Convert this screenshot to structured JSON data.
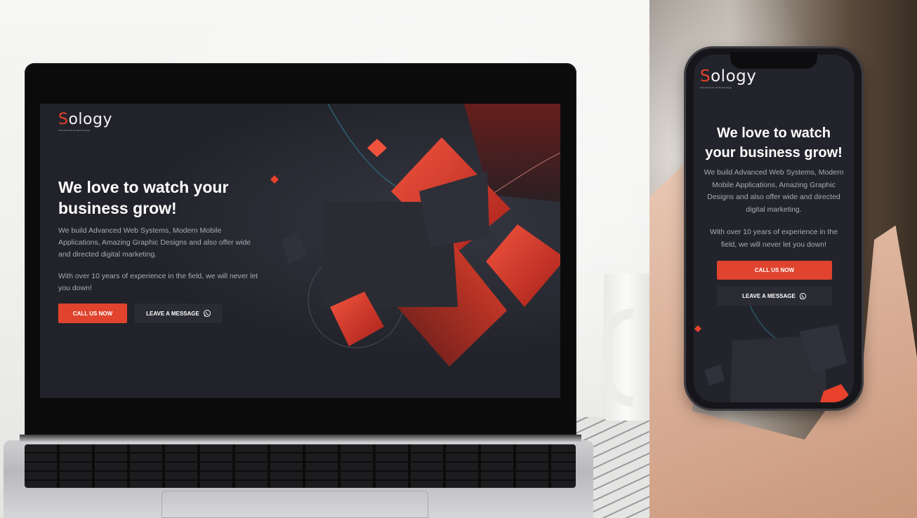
{
  "brand": {
    "logo_first": "S",
    "logo_rest": "ology",
    "tagline": "The Evolves Of Technology",
    "accent_color": "#e0442e",
    "background_color": "#22232a"
  },
  "hero": {
    "title_line1": "We love to watch your",
    "title_line2": "business grow!",
    "paragraph1": "We build Advanced Web Systems, Modern Mobile Applications, Amazing Graphic Designs and also offer wide and directed digital marketing.",
    "paragraph2": "With over 10 years of experience in the field, we will never let you down!",
    "call_button": "CALL US NOW",
    "message_button": "LEAVE A MESSAGE",
    "message_icon": "whatsapp-icon"
  },
  "mobile": {
    "title_line1": "We love to watch",
    "title_line2": "your business grow!",
    "paragraph1": "We build Advanced Web Systems, Modern Mobile Applications, Amazing Graphic Designs and also offer wide and directed digital marketing.",
    "paragraph2": "With over 10 years of experience in the field, we will never let you down!",
    "call_button": "CALL US NOW",
    "message_button": "LEAVE A MESSAGE"
  }
}
